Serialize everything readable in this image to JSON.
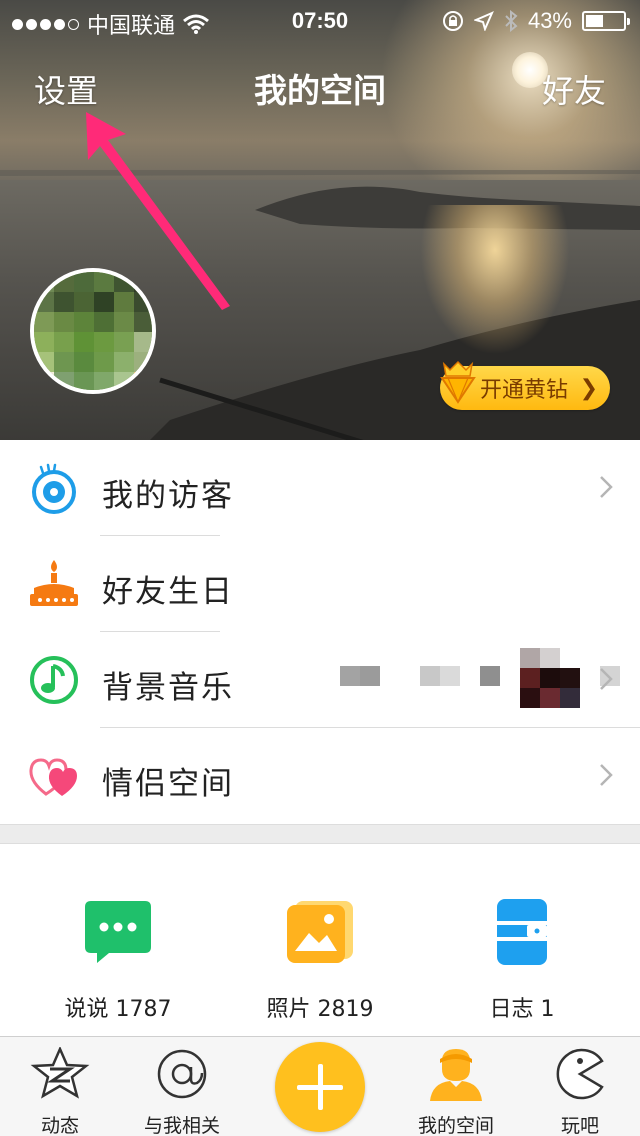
{
  "status_bar": {
    "carrier": "中国联通",
    "time": "07:50",
    "battery": "43%"
  },
  "nav": {
    "left": "设置",
    "title": "我的空间",
    "right": "好友"
  },
  "vip": {
    "label": "开通黄钻"
  },
  "menu": [
    {
      "label": "我的访客",
      "icon": "eye-icon"
    },
    {
      "label": "好友生日",
      "icon": "cake-icon"
    },
    {
      "label": "背景音乐",
      "icon": "music-note-icon"
    },
    {
      "label": "情侣空间",
      "icon": "hearts-icon"
    }
  ],
  "quick": [
    {
      "label": "说说 1787",
      "icon": "speech-bubble-icon",
      "color": "#1fc06b"
    },
    {
      "label": "照片 2819",
      "icon": "photo-icon",
      "color": "#ffb21e"
    },
    {
      "label": "日志 1",
      "icon": "notebook-icon",
      "color": "#1ea0ef"
    }
  ],
  "tabs": [
    {
      "label": "动态",
      "icon": "star-z-icon"
    },
    {
      "label": "与我相关",
      "icon": "at-icon"
    },
    {
      "label": "我的空间",
      "icon": "user-profile-icon"
    },
    {
      "label": "玩吧",
      "icon": "pacman-icon"
    }
  ],
  "colors": {
    "accent": "#ffc01e",
    "annotation_arrow": "#ff2a78"
  }
}
